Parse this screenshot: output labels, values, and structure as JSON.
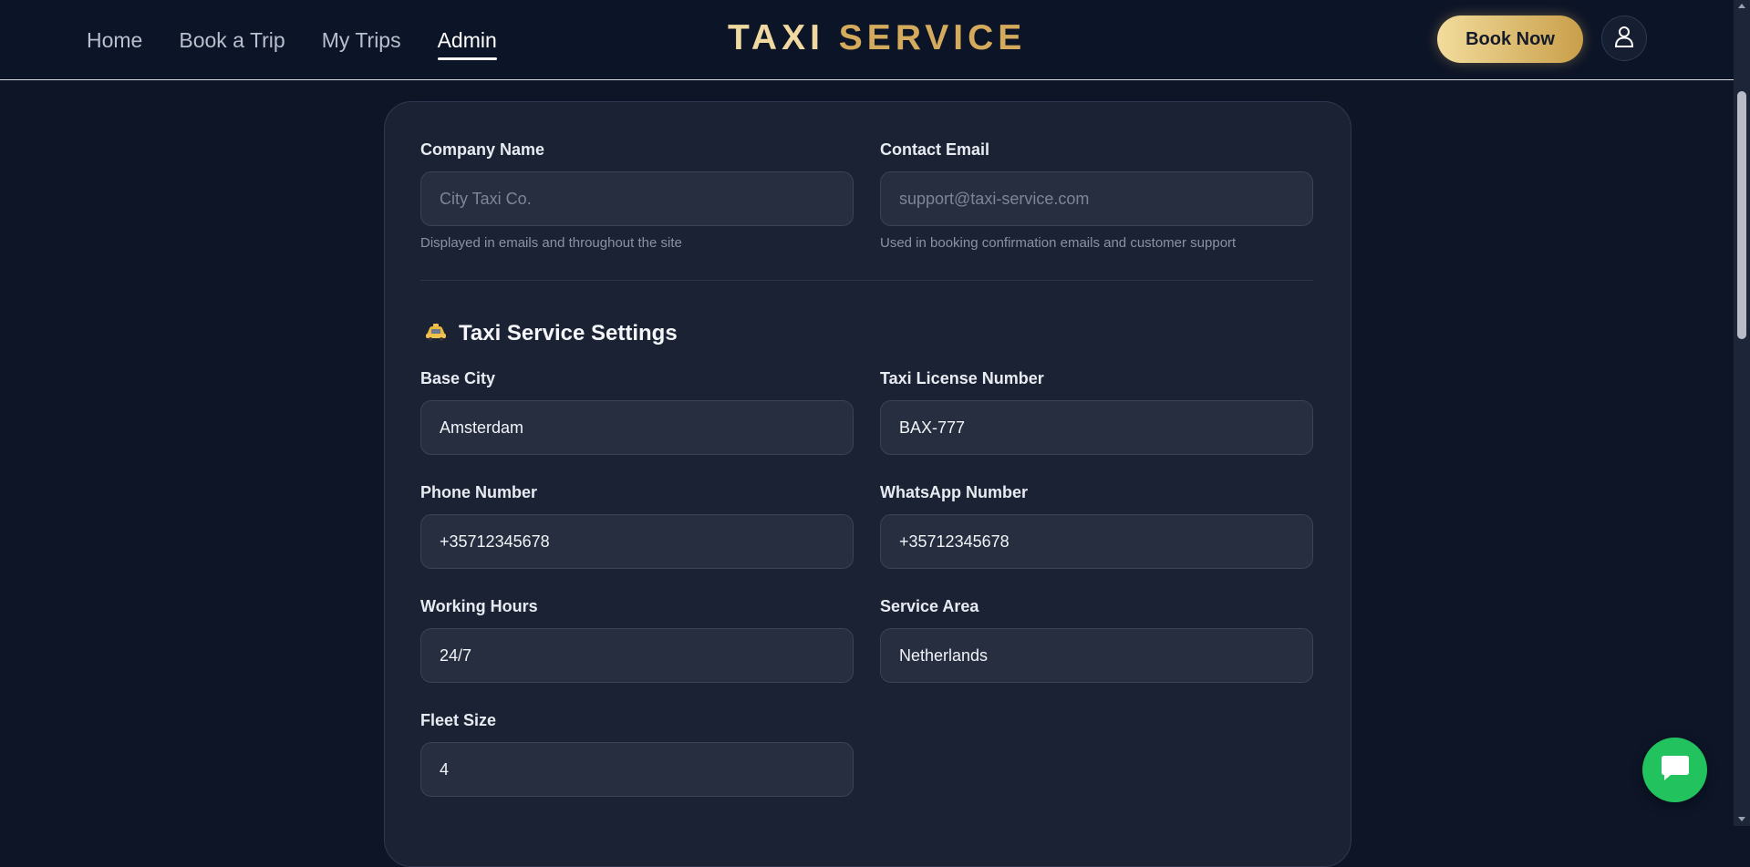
{
  "nav": {
    "items": [
      {
        "label": "Home"
      },
      {
        "label": "Book a Trip"
      },
      {
        "label": "My Trips"
      },
      {
        "label": "Admin",
        "active": true
      }
    ]
  },
  "brand": {
    "word1": "TAXI",
    "word2": "SERVICE"
  },
  "header": {
    "book_now_label": "Book Now",
    "user_icon": "user-icon"
  },
  "general": {
    "company_name": {
      "label": "Company Name",
      "placeholder": "City Taxi Co.",
      "value": "",
      "hint": "Displayed in emails and throughout the site"
    },
    "contact_email": {
      "label": "Contact Email",
      "placeholder": "support@taxi-service.com",
      "value": "",
      "hint": "Used in booking confirmation emails and customer support"
    }
  },
  "taxi_settings": {
    "title": "Taxi Service Settings",
    "icon": "taxi-icon",
    "base_city": {
      "label": "Base City",
      "value": "Amsterdam"
    },
    "license_number": {
      "label": "Taxi License Number",
      "value": "BAX-777"
    },
    "phone_number": {
      "label": "Phone Number",
      "value": "+35712345678"
    },
    "whatsapp_number": {
      "label": "WhatsApp Number",
      "value": "+35712345678"
    },
    "working_hours": {
      "label": "Working Hours",
      "value": "24/7"
    },
    "service_area": {
      "label": "Service Area",
      "value": "Netherlands"
    },
    "fleet_size": {
      "label": "Fleet Size",
      "value": "4"
    }
  },
  "colors": {
    "accent_gold": "#d4aa5c",
    "chat_green": "#22c35e",
    "background": "#0d1527"
  },
  "chat": {
    "icon": "chat-bubble-icon"
  }
}
